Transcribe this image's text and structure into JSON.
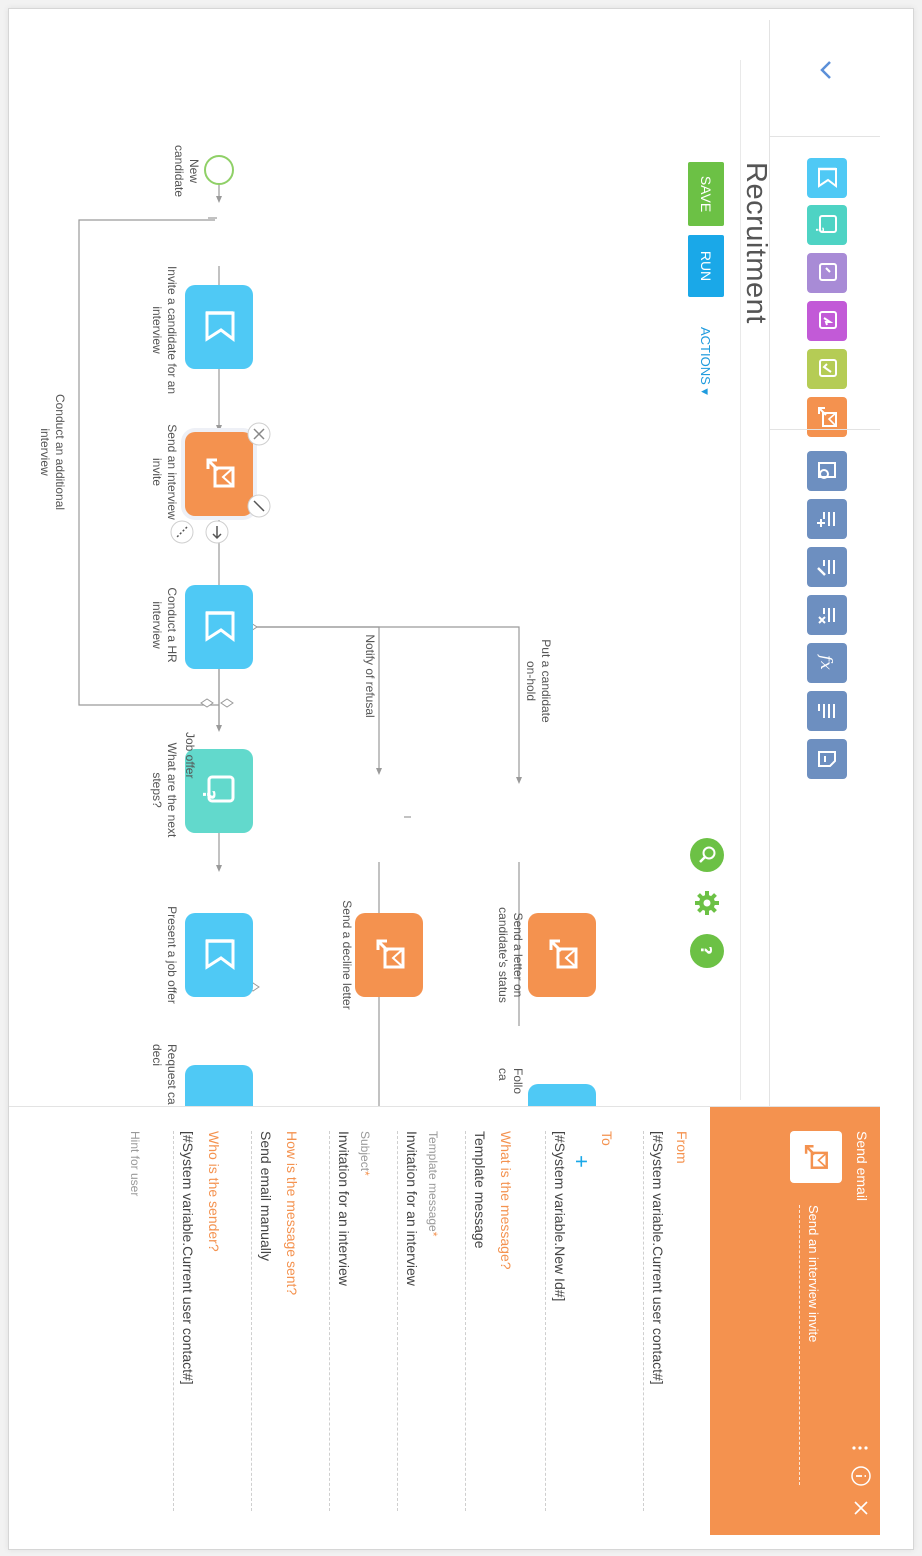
{
  "palette": {
    "expand_icon": "chevron-down-icon",
    "user_tasks": [
      {
        "icon": "user-task-icon",
        "color": "#4fc9f5"
      },
      {
        "icon": "question-task-icon",
        "color": "#4ed3c4"
      },
      {
        "icon": "activity-task-icon",
        "color": "#a88bd6"
      },
      {
        "icon": "call-task-icon",
        "color": "#c25ad7"
      },
      {
        "icon": "approval-task-icon",
        "color": "#b5cc55"
      },
      {
        "icon": "send-email-icon",
        "color": "#f4924f"
      }
    ],
    "system_actions": [
      {
        "icon": "read-data-icon"
      },
      {
        "icon": "add-data-icon"
      },
      {
        "icon": "modify-data-icon"
      },
      {
        "icon": "delete-data-icon"
      },
      {
        "icon": "formula-icon"
      },
      {
        "icon": "generate-document-icon"
      },
      {
        "icon": "process-file-icon"
      }
    ],
    "system_color": "#6d8fc0"
  },
  "header": {
    "title": "Recruitment",
    "save_label": "SAVE",
    "run_label": "RUN",
    "actions_label": "ACTIONS ▾"
  },
  "tools": [
    "search-icon",
    "gear-icon",
    "help-icon"
  ],
  "diagram": {
    "start_label": "New candidate",
    "nodes": {
      "invite": "Invite a candidate for an interview",
      "send_invite": "Send an interview invite",
      "hr_interview": "Conduct a HR interview",
      "next_steps": "What are the next steps?",
      "job_offer": "Present a job offer",
      "request": "Request ca deci",
      "decline_letter": "Send a decline letter",
      "status_letter": "Send a letter on candidate's status",
      "follow": "Follo ca"
    },
    "flows": {
      "additional": "Conduct an additional interview",
      "refusal": "Notify of refusal",
      "on_hold": "Put a candidate on-hold",
      "job_offer": "Job offer"
    }
  },
  "panel": {
    "header_title": "Send email",
    "element_name": "Send an interview invite",
    "from_label": "From",
    "from_value": "[#System variable.Current user contact#]",
    "to_label": "To",
    "to_value": "[#System variable.New Id#]",
    "message_label": "What is the message?",
    "message_value": "Template message",
    "template_label": "Template message",
    "template_value": "Invitation for an interview",
    "subject_label": "Subject",
    "subject_value": "Invitation for an interview",
    "sent_label": "How is the message sent?",
    "sent_value": "Send email manually",
    "sender_label": "Who is the sender?",
    "sender_value": "[#System variable.Current user contact#]",
    "hint_label": "Hint for user",
    "required_mark": "*"
  },
  "colors": {
    "user_task": "#4fc9f5",
    "email_task": "#f4924f",
    "gateway": "#62d9cc",
    "save": "#6cc145",
    "run": "#1aa8e8"
  }
}
